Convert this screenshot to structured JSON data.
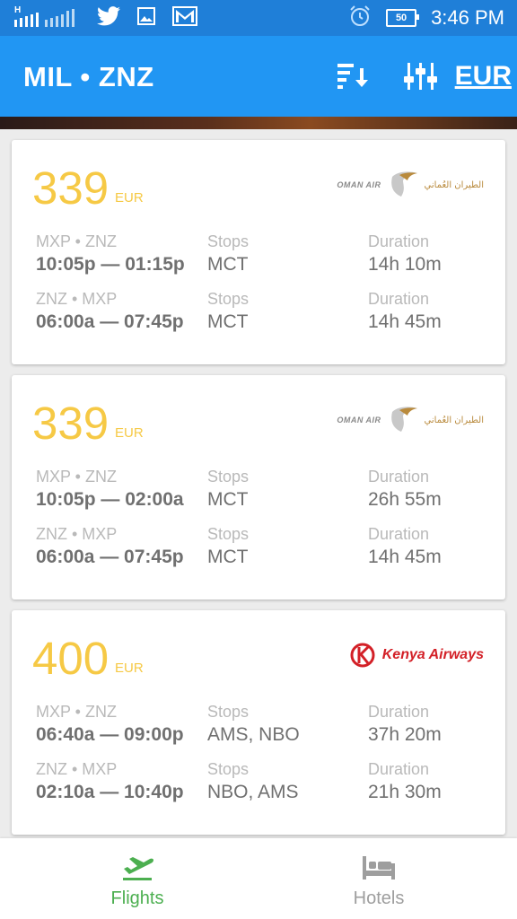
{
  "status_bar": {
    "network": "H",
    "battery": "50",
    "time": "3:46 PM",
    "icons": [
      "signal-icon",
      "twitter-icon",
      "gallery-icon",
      "gmail-icon",
      "alarm-icon",
      "battery-icon"
    ]
  },
  "header": {
    "route": "MIL • ZNZ",
    "currency": "EUR",
    "icons": [
      "sort-icon",
      "filter-icon"
    ],
    "color": "#2196f3"
  },
  "offers": [
    {
      "price": "339",
      "currency": "EUR",
      "airline": "Oman Air",
      "airline_logo_text": "OMAN AIR",
      "airline_logo_arabic": "الطيران العُماني",
      "legs": [
        {
          "route": "MXP • ZNZ",
          "times": "10:05p — 01:15p",
          "stops_label": "Stops",
          "stops": "MCT",
          "duration_label": "Duration",
          "duration": "14h 10m"
        },
        {
          "route": "ZNZ • MXP",
          "times": "06:00a — 07:45p",
          "stops_label": "Stops",
          "stops": "MCT",
          "duration_label": "Duration",
          "duration": "14h 45m"
        }
      ]
    },
    {
      "price": "339",
      "currency": "EUR",
      "airline": "Oman Air",
      "airline_logo_text": "OMAN AIR",
      "airline_logo_arabic": "الطيران العُماني",
      "legs": [
        {
          "route": "MXP • ZNZ",
          "times": "10:05p — 02:00a",
          "stops_label": "Stops",
          "stops": "MCT",
          "duration_label": "Duration",
          "duration": "26h 55m"
        },
        {
          "route": "ZNZ • MXP",
          "times": "06:00a — 07:45p",
          "stops_label": "Stops",
          "stops": "MCT",
          "duration_label": "Duration",
          "duration": "14h 45m"
        }
      ]
    },
    {
      "price": "400",
      "currency": "EUR",
      "airline": "Kenya Airways",
      "airline_logo_text": "Kenya Airways",
      "legs": [
        {
          "route": "MXP • ZNZ",
          "times": "06:40a — 09:00p",
          "stops_label": "Stops",
          "stops": "AMS, NBO",
          "duration_label": "Duration",
          "duration": "37h 20m"
        },
        {
          "route": "ZNZ • MXP",
          "times": "02:10a — 10:40p",
          "stops_label": "Stops",
          "stops": "NBO, AMS",
          "duration_label": "Duration",
          "duration": "21h 30m"
        }
      ]
    }
  ],
  "bottom_nav": {
    "tabs": [
      {
        "label": "Flights",
        "icon": "flight-takeoff-icon",
        "active": true
      },
      {
        "label": "Hotels",
        "icon": "bed-icon",
        "active": false
      }
    ],
    "active_color": "#4caf50",
    "inactive_color": "#9e9e9e"
  },
  "colors": {
    "price": "#f6c945",
    "kenya_red": "#d32027",
    "oman_gold": "#b98a3c"
  }
}
